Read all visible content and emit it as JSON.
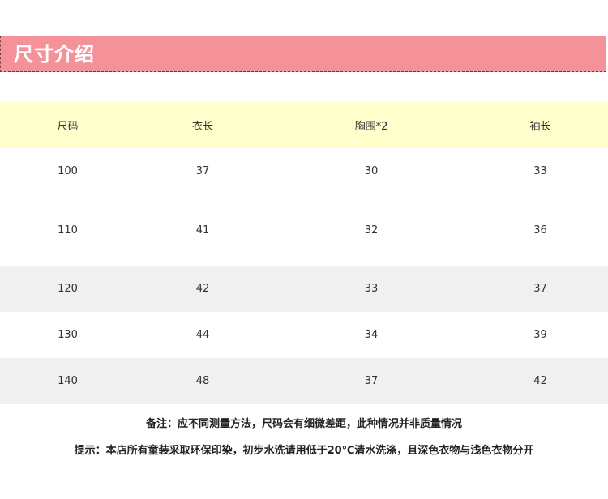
{
  "banner": {
    "title": "尺寸介绍",
    "color": "#f49199"
  },
  "table": {
    "headers": [
      "尺码",
      "衣长",
      "胸围*2",
      "袖长"
    ],
    "rows": [
      [
        "100",
        "37",
        "30",
        "33"
      ],
      [
        "110",
        "41",
        "32",
        "36"
      ],
      [
        "120",
        "42",
        "33",
        "37"
      ],
      [
        "130",
        "44",
        "34",
        "39"
      ],
      [
        "140",
        "48",
        "37",
        "42"
      ]
    ],
    "header_bg": "#ffffcc",
    "shade_bg": "#f0f0f0"
  },
  "notes": {
    "note1": "备注：应不同测量方法，尺码会有细微差距，此种情况并非质量情况",
    "note2": "提示：本店所有童装采取环保印染，初步水洗请用低于20℃清水洗涤，且深色衣物与浅色衣物分开"
  }
}
